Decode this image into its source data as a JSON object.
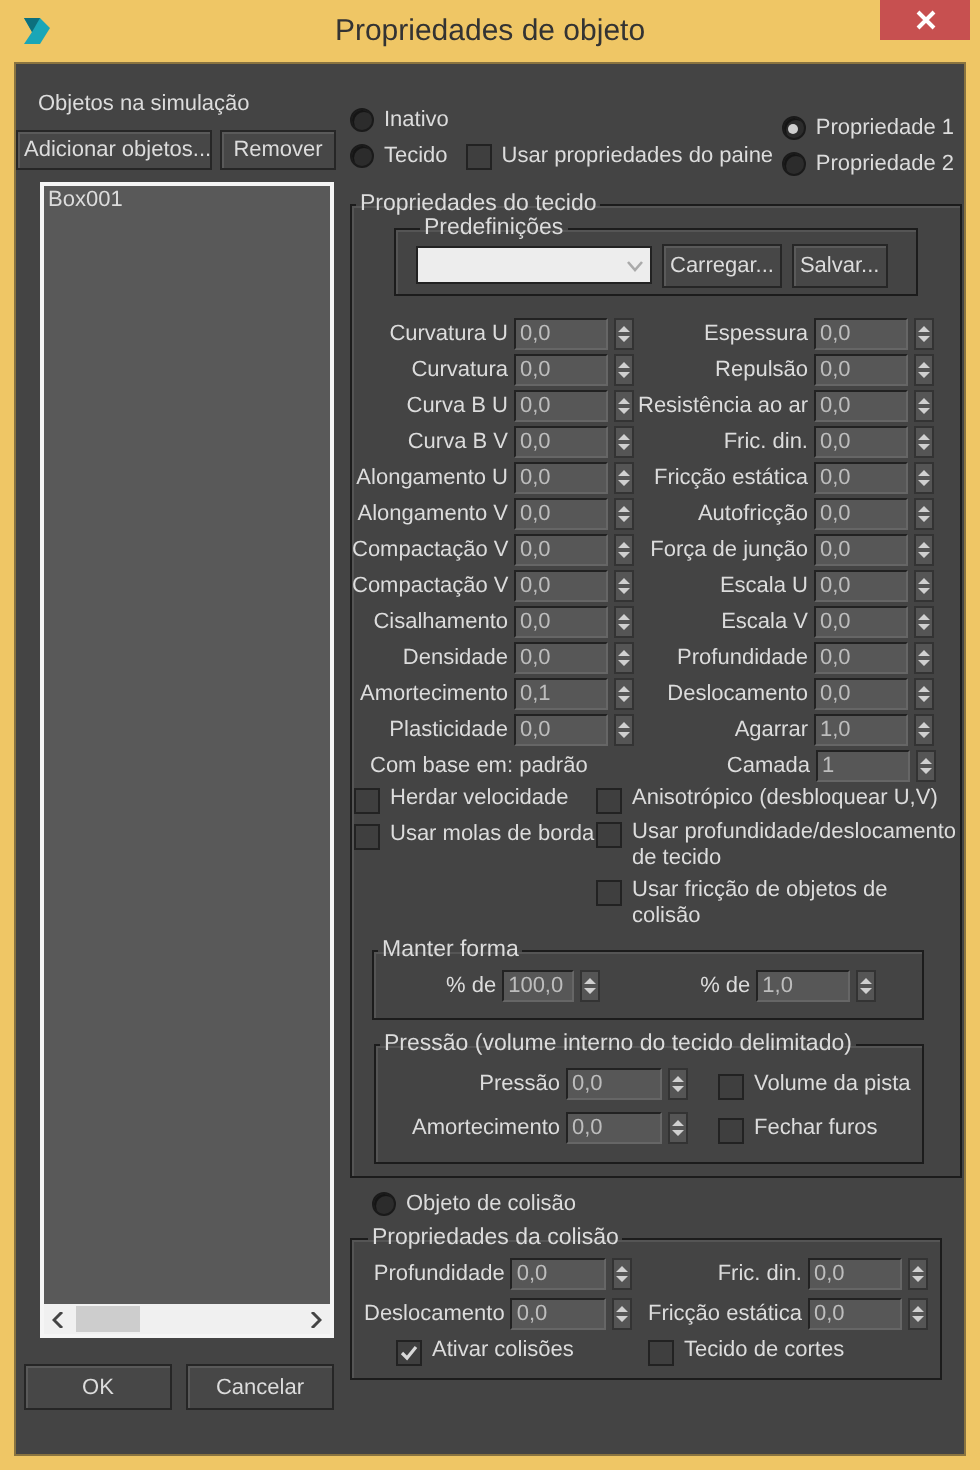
{
  "window": {
    "title": "Propriedades de objeto"
  },
  "objects_panel": {
    "label": "Objetos na simulação",
    "buttons": [
      "Adicionar objetos...",
      "Remover"
    ],
    "list": [
      {
        "label": "Box001",
        "selected": false
      }
    ]
  },
  "footer_buttons": [
    "OK",
    "Cancelar"
  ],
  "type_options": [
    {
      "label": "Inativo",
      "selected": false
    },
    {
      "label": "Tecido",
      "selected": false
    },
    {
      "label": "Objeto de colisão",
      "selected": false
    }
  ],
  "use_panel_properties": {
    "label": "Usar propriedades do paine",
    "checked": false
  },
  "property_sets": [
    {
      "label": "Propriedade 1",
      "selected": true
    },
    {
      "label": "Propriedade 2",
      "selected": false
    }
  ],
  "cloth_properties": {
    "title": "Propriedades do tecido",
    "presets": {
      "title": "Predefinições",
      "buttons": [
        "Carregar...",
        "Salvar..."
      ]
    },
    "left_params": [
      {
        "label": "Curvatura U",
        "value": "0,0"
      },
      {
        "label": "Curvatura",
        "value": "0,0"
      },
      {
        "label": "Curva B U",
        "value": "0,0"
      },
      {
        "label": "Curva B V",
        "value": "0,0"
      },
      {
        "label": "Alongamento U",
        "value": "0,0"
      },
      {
        "label": "Alongamento V",
        "value": "0,0"
      },
      {
        "label": "Compactação V",
        "value": "0,0"
      },
      {
        "label": "Compactação V",
        "value": "0,0"
      },
      {
        "label": "Cisalhamento",
        "value": "0,0"
      },
      {
        "label": "Densidade",
        "value": "0,0"
      },
      {
        "label": "Amortecimento",
        "value": "0,1"
      },
      {
        "label": "Plasticidade",
        "value": "0,0"
      }
    ],
    "right_params": [
      {
        "label": "Espessura",
        "value": "0,0"
      },
      {
        "label": "Repulsão",
        "value": "0,0"
      },
      {
        "label": "Resistência ao ar",
        "value": "0,0"
      },
      {
        "label": "Fric. din.",
        "value": "0,0"
      },
      {
        "label": "Fricção estática",
        "value": "0,0"
      },
      {
        "label": "Autofricção",
        "value": "0,0"
      },
      {
        "label": "Força de junção",
        "value": "0,0"
      },
      {
        "label": "Escala U",
        "value": "0,0"
      },
      {
        "label": "Escala V",
        "value": "0,0"
      },
      {
        "label": "Profundidade",
        "value": "0,0"
      },
      {
        "label": "Deslocamento",
        "value": "0,0"
      },
      {
        "label": "Agarrar",
        "value": "1,0"
      }
    ],
    "based_on": "Com base em: padrão",
    "layer": {
      "label": "Camada",
      "value": "1"
    },
    "left_checkboxes": [
      {
        "label": "Herdar velocidade",
        "checked": false
      },
      {
        "label": "Usar molas de borda",
        "checked": false
      }
    ],
    "right_checkboxes": [
      {
        "label": "Anisotrópico (desbloquear U,V)",
        "checked": false
      },
      {
        "label": "Usar profundidade/deslocamento de tecido",
        "checked": false
      },
      {
        "label": "Usar fricção de objetos de colisão",
        "checked": false
      }
    ],
    "keep_shape": {
      "title": "Manter forma",
      "fields": [
        {
          "label": "% de",
          "value": "100,0"
        },
        {
          "label": "% de",
          "value": "1,0"
        }
      ]
    },
    "pressure": {
      "title": "Pressão (volume interno do tecido delimitado)",
      "fields": [
        {
          "label": "Pressão",
          "value": "0,0"
        },
        {
          "label": "Amortecimento",
          "value": "0,0"
        }
      ],
      "checkboxes": [
        {
          "label": "Volume da pista",
          "checked": false
        },
        {
          "label": "Fechar furos",
          "checked": false
        }
      ]
    }
  },
  "collision_properties": {
    "title": "Propriedades da colisão",
    "left_params": [
      {
        "label": "Profundidade",
        "value": "0,0"
      },
      {
        "label": "Deslocamento",
        "value": "0,0"
      }
    ],
    "right_params": [
      {
        "label": "Fric. din.",
        "value": "0,0"
      },
      {
        "label": "Fricção estática",
        "value": "0,0"
      }
    ],
    "checkboxes": [
      {
        "label": "Ativar colisões",
        "checked": true
      },
      {
        "label": "Tecido de cortes",
        "checked": false
      }
    ]
  }
}
